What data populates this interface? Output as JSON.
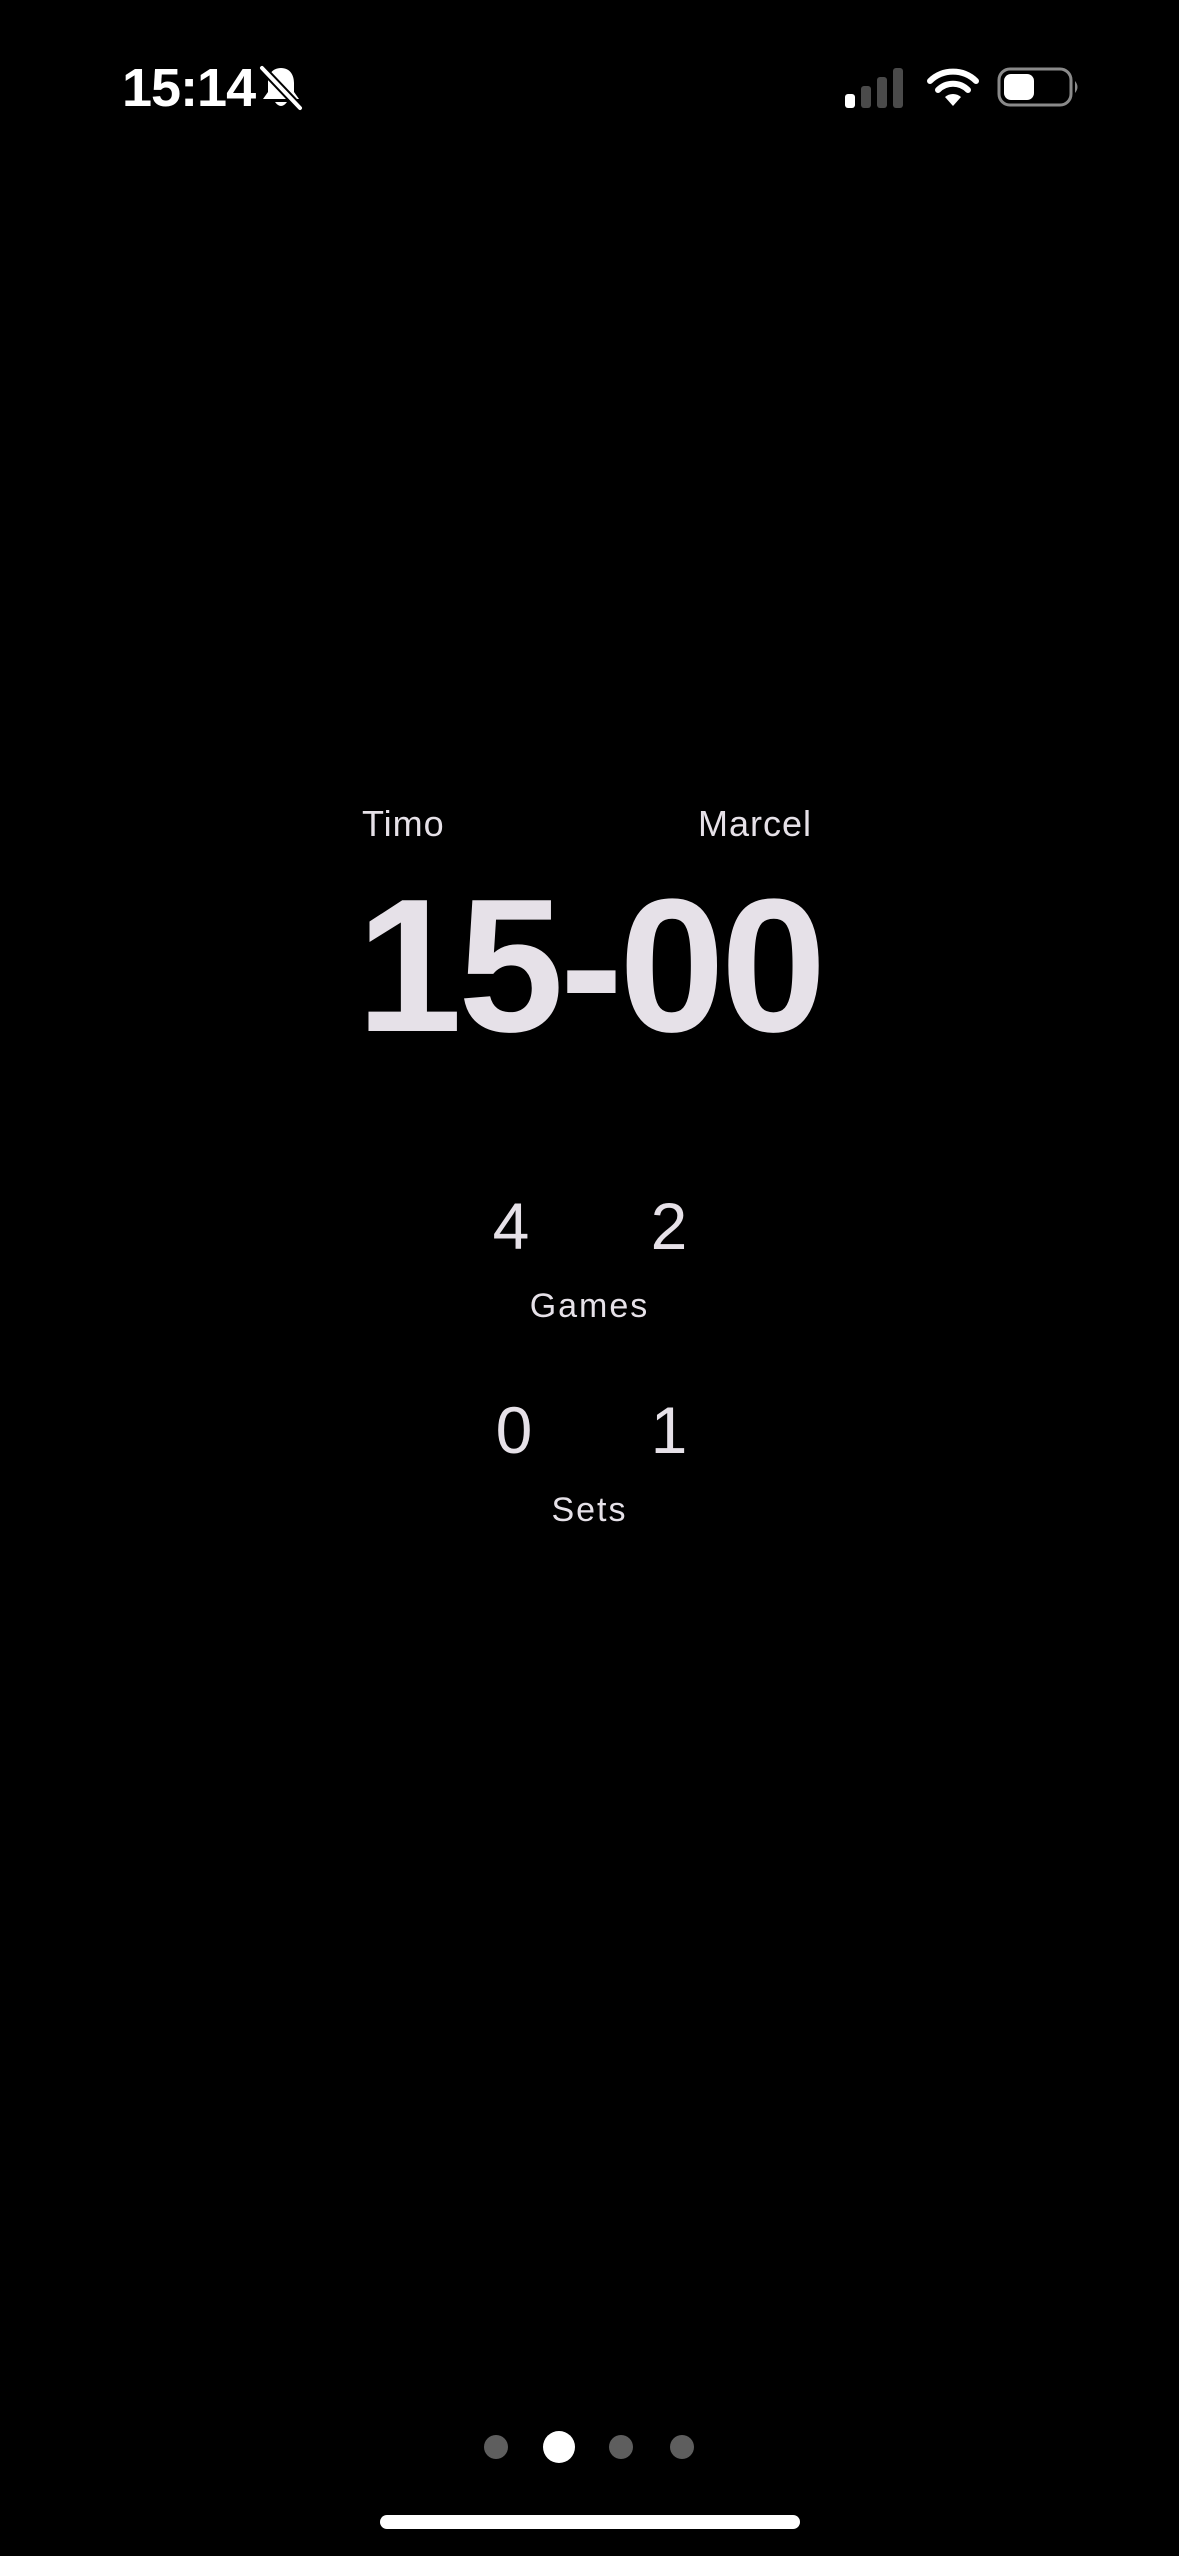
{
  "status_bar": {
    "time": "15:14",
    "icons": [
      "bell-slash-icon",
      "cellular-signal-icon",
      "wifi-icon",
      "battery-icon"
    ],
    "signal_bars_active": 1,
    "signal_bars_total": 4,
    "battery_level": 0.45
  },
  "scoreboard": {
    "players": {
      "left": "Timo",
      "right": "Marcel"
    },
    "points": {
      "left": "15",
      "separator": "-",
      "right": "00"
    },
    "games": {
      "left": "4",
      "right": "2",
      "label": "Games"
    },
    "sets": {
      "left": "0",
      "right": "1",
      "label": "Sets"
    }
  },
  "pager": {
    "page_count": 4,
    "current_page": 2
  },
  "colors": {
    "background": "#000000",
    "text": "#e6e1e8",
    "dot_active": "#ffffff",
    "dot_inactive": "#5e5e5e"
  }
}
